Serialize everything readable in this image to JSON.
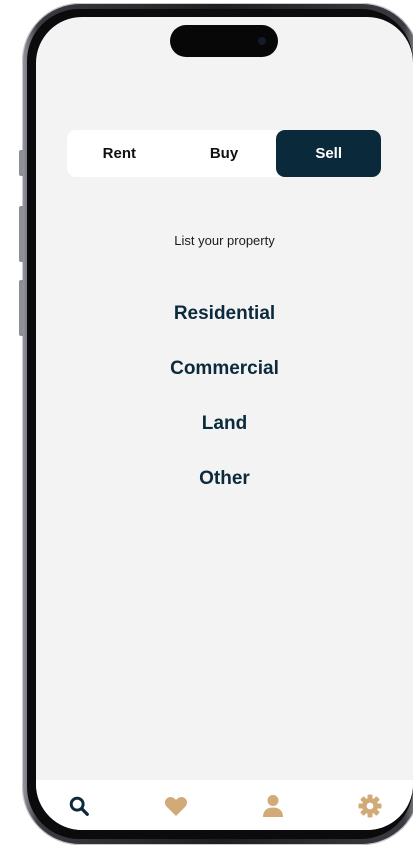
{
  "segmented_control": {
    "items": [
      {
        "label": "Rent"
      },
      {
        "label": "Buy"
      },
      {
        "label": "Sell"
      }
    ],
    "selected": "Sell"
  },
  "main": {
    "subtitle": "List your property",
    "options": [
      {
        "label": "Residential"
      },
      {
        "label": "Commercial"
      },
      {
        "label": "Land"
      },
      {
        "label": "Other"
      }
    ]
  },
  "tab_bar": {
    "items": [
      {
        "icon": "search-icon",
        "active": true
      },
      {
        "icon": "heart-icon",
        "active": false
      },
      {
        "icon": "user-icon",
        "active": false
      },
      {
        "icon": "gear-icon",
        "active": false
      }
    ]
  },
  "colors": {
    "primary_navy": "#0a2a3c",
    "accent_tan": "#d1aa78",
    "screen_background": "#f3f3f3"
  }
}
